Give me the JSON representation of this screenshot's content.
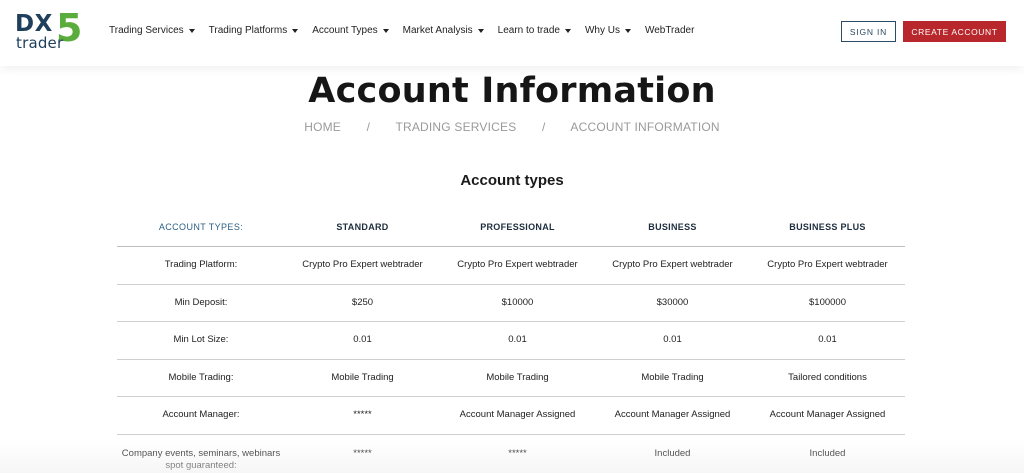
{
  "header": {
    "logo": {
      "dx": "DX",
      "five": "5",
      "trader": "trader"
    },
    "nav": [
      {
        "label": "Trading Services",
        "dropdown": true
      },
      {
        "label": "Trading Platforms",
        "dropdown": true
      },
      {
        "label": "Account Types",
        "dropdown": true
      },
      {
        "label": "Market Analysis",
        "dropdown": true
      },
      {
        "label": "Learn to trade",
        "dropdown": true
      },
      {
        "label": "Why Us",
        "dropdown": true
      },
      {
        "label": "WebTrader",
        "dropdown": false
      }
    ],
    "signin_label": "SIGN IN",
    "create_label": "CREATE ACCOUNT",
    "colors": {
      "brand_navy": "#1f3f5c",
      "brand_green": "#5aac3c",
      "cta_red": "#b8272b"
    }
  },
  "hero": {
    "title": "Account Information",
    "breadcrumb": [
      "HOME",
      "TRADING SERVICES",
      "ACCOUNT INFORMATION"
    ],
    "separator": "/"
  },
  "table": {
    "title": "Account types",
    "headers": [
      "ACCOUNT TYPES:",
      "STANDARD",
      "PROFESSIONAL",
      "BUSINESS",
      "BUSINESS PLUS"
    ],
    "rows": [
      {
        "label": "Trading Platform:",
        "values": [
          "Crypto Pro Expert webtrader",
          "Crypto Pro Expert webtrader",
          "Crypto Pro Expert webtrader",
          "Crypto Pro Expert webtrader"
        ]
      },
      {
        "label": "Min Deposit:",
        "values": [
          "$250",
          "$10000",
          "$30000",
          "$100000"
        ]
      },
      {
        "label": "Min Lot Size:",
        "values": [
          "0.01",
          "0.01",
          "0.01",
          "0.01"
        ]
      },
      {
        "label": "Mobile Trading:",
        "values": [
          "Mobile Trading",
          "Mobile Trading",
          "Mobile Trading",
          "Tailored conditions"
        ]
      },
      {
        "label": "Account Manager:",
        "values": [
          "*****",
          "Account Manager Assigned",
          "Account Manager Assigned",
          "Account Manager Assigned"
        ]
      },
      {
        "label": "Company events, seminars, webinars spot guaranteed:",
        "values": [
          "*****",
          "*****",
          "Included",
          "Included"
        ]
      }
    ]
  }
}
